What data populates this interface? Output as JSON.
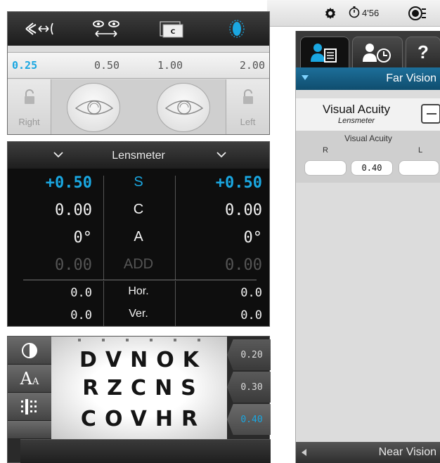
{
  "status": {
    "timer": "4'56"
  },
  "steps": [
    "0.25",
    "0.50",
    "1.00",
    "2.00"
  ],
  "active_step": "0.25",
  "eyes": {
    "right_label": "Right",
    "left_label": "Left"
  },
  "lensmeter": {
    "title": "Lensmeter",
    "rows": [
      {
        "left": "+0.50",
        "mid": "S",
        "right": "+0.50"
      },
      {
        "left": "0.00",
        "mid": "C",
        "right": "0.00"
      },
      {
        "left": "0°",
        "mid": "A",
        "right": "0°"
      },
      {
        "left": "0.00",
        "mid": "ADD",
        "right": "0.00"
      },
      {
        "left": "0.0",
        "mid": "Hor.",
        "right": "0.0"
      },
      {
        "left": "0.0",
        "mid": "Ver.",
        "right": "0.0"
      }
    ]
  },
  "chart": {
    "lines": [
      "DVNOK",
      "RZCNS",
      "COVHR"
    ],
    "acuity_tabs": [
      "0.20",
      "0.30",
      "0.40"
    ],
    "active_acuity": "0.40",
    "text_size_icon_label": "A",
    "text_size_icon_small": "A"
  },
  "right_panel": {
    "help_label": "?",
    "far_vision": "Far Vision",
    "test_title": "Visual Acuity",
    "test_subtitle": "Lensmeter",
    "block_header": "Visual Acuity",
    "r_label": "R",
    "l_label": "L",
    "value_r": "",
    "value_binocular": "0.40",
    "value_l": "",
    "near_vision": "Near Vision"
  },
  "colors": {
    "accent": "#1aa7e1",
    "far_bar": "#1d6f9a"
  }
}
